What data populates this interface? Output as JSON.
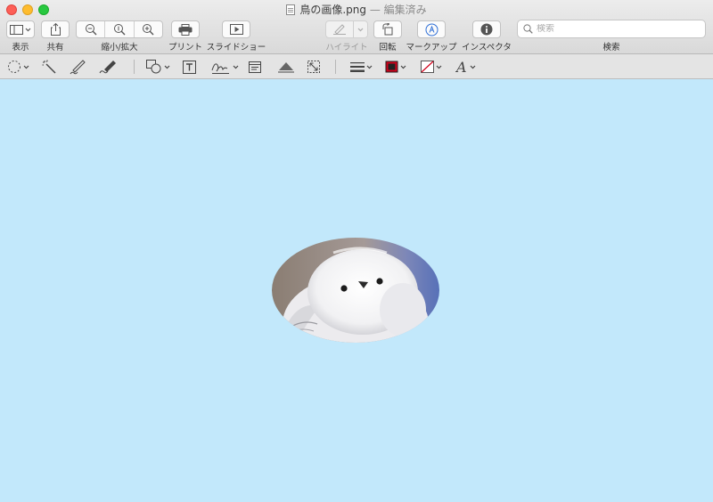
{
  "window": {
    "filename": "鳥の画像.png",
    "separator": "—",
    "edited_label": "編集済み"
  },
  "toolbar": {
    "view_label": "表示",
    "share_label": "共有",
    "zoom_label": "縮小/拡大",
    "print_label": "プリント",
    "slideshow_label": "スライドショー",
    "highlight_label": "ハイライト",
    "rotate_label": "回転",
    "markup_label": "マークアップ",
    "inspector_label": "インスペクタ",
    "search_label": "検索",
    "search_placeholder": "検索"
  },
  "markup_tools": [
    "selection-tools",
    "instant-alpha",
    "sketch",
    "draw",
    "shapes",
    "text",
    "sign",
    "note",
    "adjust-color",
    "adjust-size",
    "shape-style",
    "border-color",
    "fill-color",
    "text-style"
  ],
  "colors": {
    "canvas_background": "#c2e8fb",
    "border_color_swatch": "#d0021b",
    "markup_accent": "#2f6fd6"
  },
  "image": {
    "subject": "bird photo cropped to ellipse",
    "shape": "ellipse"
  }
}
